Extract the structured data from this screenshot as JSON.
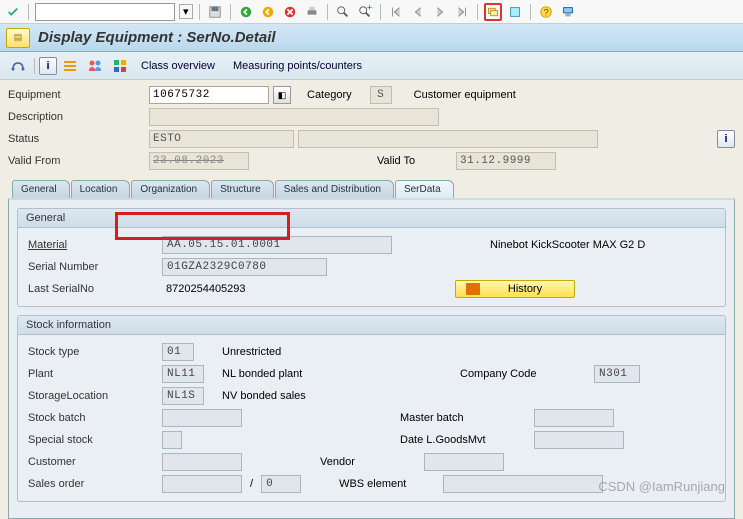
{
  "title": "Display Equipment : SerNo.Detail",
  "action_buttons": {
    "class_overview": "Class overview",
    "measuring": "Measuring points/counters"
  },
  "form": {
    "equipment_label": "Equipment",
    "equipment_value": "10675732",
    "category_label": "Category",
    "category_value": "S",
    "category_text": "Customer equipment",
    "description_label": "Description",
    "description_value": "",
    "status_label": "Status",
    "status_value": "ESTO",
    "valid_from_label": "Valid From",
    "valid_from_value": "23.08.2023",
    "valid_to_label": "Valid To",
    "valid_to_value": "31.12.9999"
  },
  "tabs": [
    "General",
    "Location",
    "Organization",
    "Structure",
    "Sales and Distribution",
    "SerData"
  ],
  "general_group": {
    "title": "General",
    "material_label": "Material",
    "material_value": "AA.05.15.01.0001",
    "material_text": "Ninebot KickScooter MAX G2 D",
    "serial_label": "Serial Number",
    "serial_value": "01GZA2329C0780",
    "last_serial_label": "Last SerialNo",
    "last_serial_value": "8720254405293",
    "history_label": "History"
  },
  "stock_group": {
    "title": "Stock information",
    "stock_type_label": "Stock type",
    "stock_type_value": "01",
    "stock_type_text": "Unrestricted",
    "plant_label": "Plant",
    "plant_value": "NL11",
    "plant_text": "NL bonded plant",
    "company_code_label": "Company Code",
    "company_code_value": "N301",
    "storage_loc_label": "StorageLocation",
    "storage_loc_value": "NL1S",
    "storage_loc_text": "NV bonded sales",
    "stock_batch_label": "Stock batch",
    "stock_batch_value": "",
    "master_batch_label": "Master batch",
    "master_batch_value": "",
    "special_stock_label": "Special stock",
    "special_stock_value": "",
    "date_goods_label": "Date L.GoodsMvt",
    "date_goods_value": "",
    "customer_label": "Customer",
    "customer_value": "",
    "vendor_label": "Vendor",
    "vendor_value": "",
    "sales_order_label": "Sales order",
    "sales_order_value": "",
    "sales_order_item": "0",
    "wbs_label": "WBS element",
    "wbs_value": ""
  },
  "watermark": "CSDN @IamRunjiang"
}
